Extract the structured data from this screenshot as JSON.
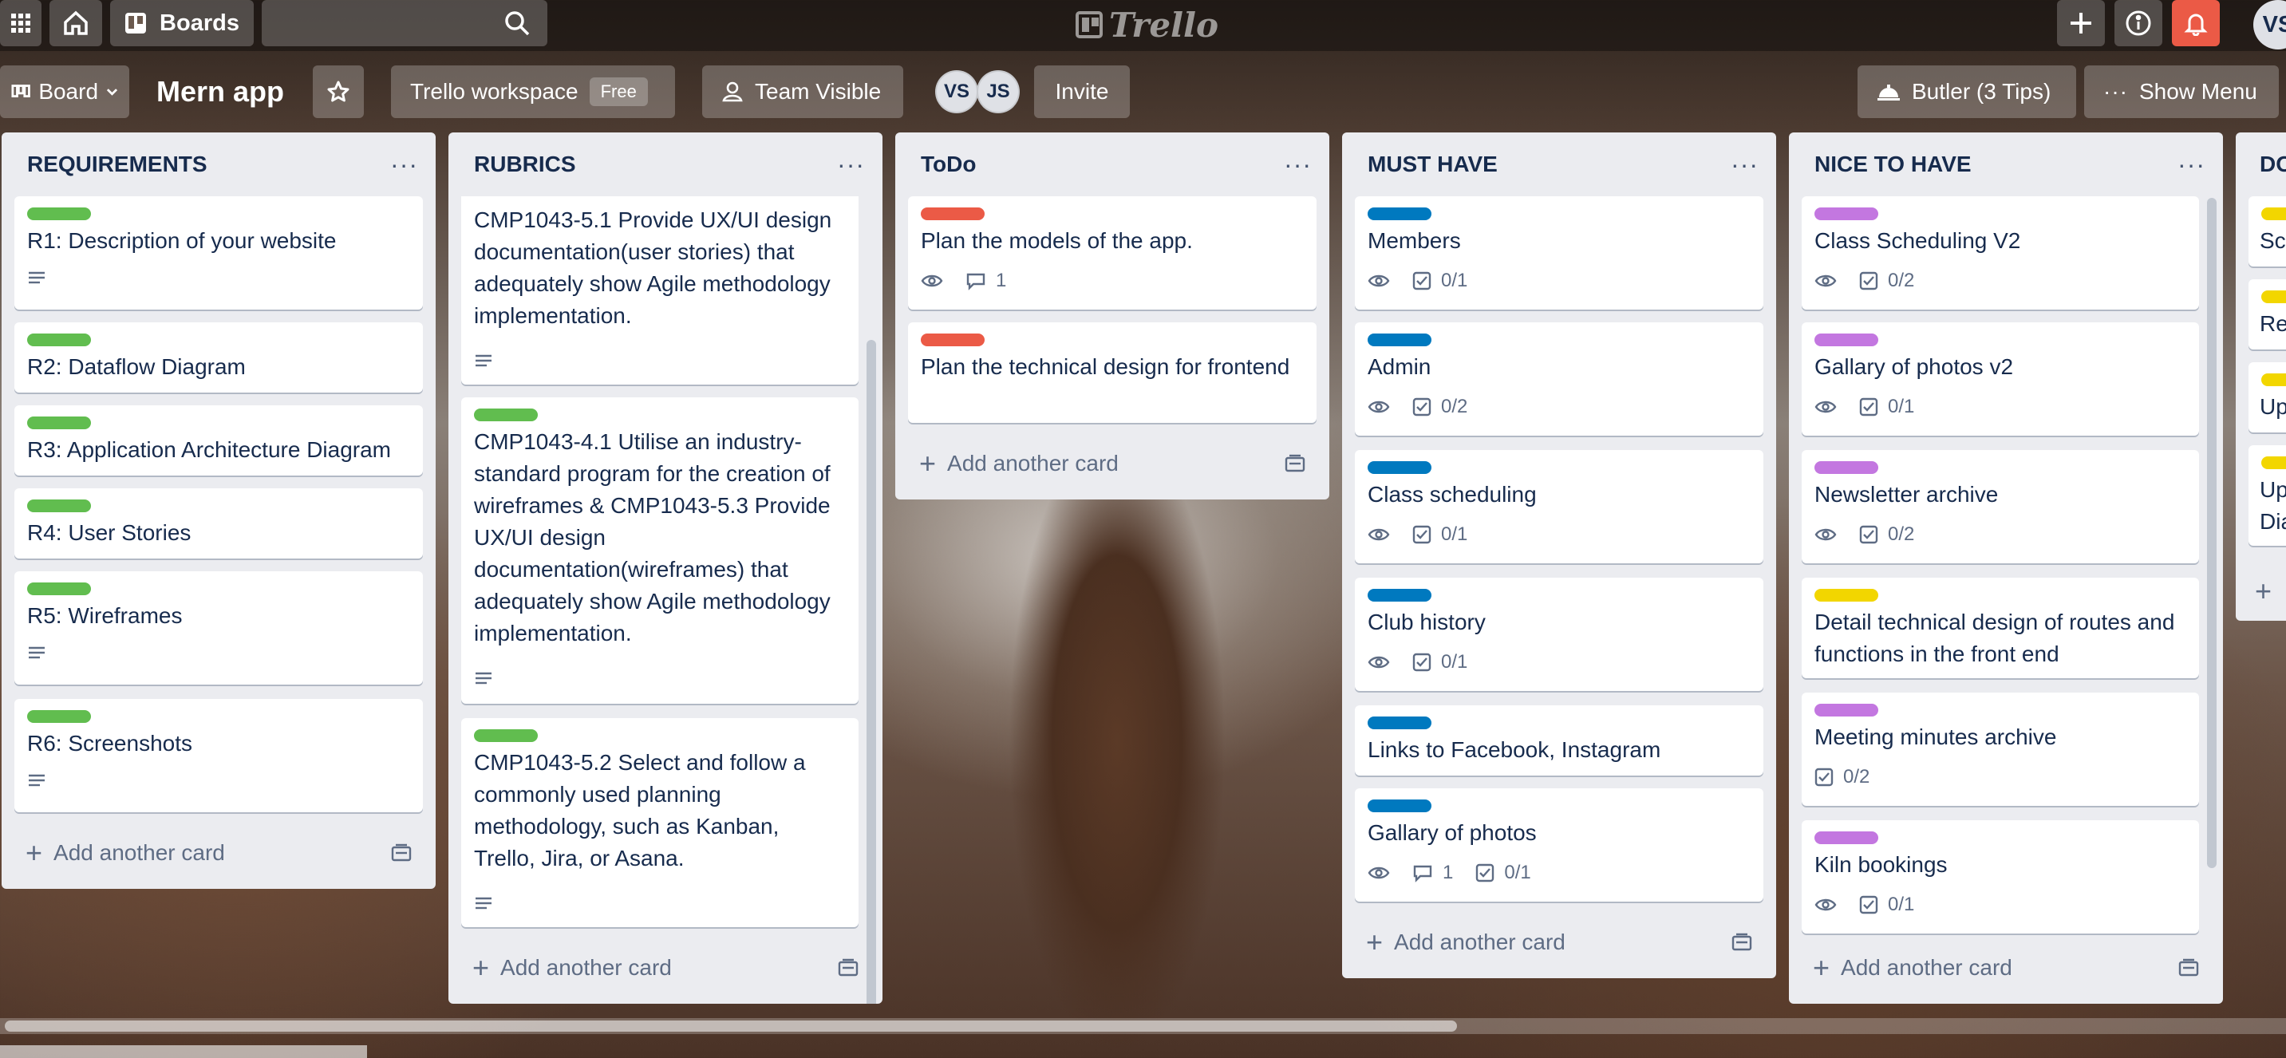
{
  "topbar": {
    "boards_label": "Boards",
    "logo_text": "Trello",
    "user_initials": "VS",
    "notification_color": "#eb5a46"
  },
  "boardbar": {
    "view_label": "Board",
    "board_title": "Mern app",
    "workspace_label": "Trello workspace",
    "workspace_plan": "Free",
    "visibility_label": "Team Visible",
    "members": [
      "VS",
      "JS"
    ],
    "invite_label": "Invite",
    "butler_label": "Butler (3 Tips)",
    "show_menu_label": "Show Menu"
  },
  "colors": {
    "green": "#61bd4f",
    "red": "#eb5a46",
    "blue": "#0079bf",
    "purple": "#c377e0",
    "yellow": "#f2d600"
  },
  "lists": [
    {
      "title": "REQUIREMENTS",
      "add_card_label": "Add another card",
      "cards": [
        {
          "label_color": "green",
          "text": "R1: Description of your website",
          "description": true
        },
        {
          "label_color": "green",
          "text": "R2: Dataflow Diagram"
        },
        {
          "label_color": "green",
          "text": "R3: Application Architecture Diagram"
        },
        {
          "label_color": "green",
          "text": "R4: User Stories"
        },
        {
          "label_color": "green",
          "text": "R5: Wireframes",
          "description": true
        },
        {
          "label_color": "green",
          "text": "R6: Screenshots",
          "description": true
        }
      ]
    },
    {
      "title": "RUBRICS",
      "add_card_label": "Add another card",
      "cards": [
        {
          "label_color": "green",
          "text": "CMP1043-5.1 Provide UX/UI design documentation(user stories) that adequately show Agile methodology implementation.",
          "description": true
        },
        {
          "label_color": "green",
          "text": "CMP1043-4.1 Utilise an industry-standard program for the creation of wireframes & CMP1043-5.3 Provide UX/UI design documentation(wireframes) that adequately show Agile methodology implementation.",
          "description": true
        },
        {
          "label_color": "green",
          "text": "CMP1043-5.2 Select and follow a commonly used planning methodology, such as Kanban, Trello, Jira, or Asana.",
          "description": true
        }
      ]
    },
    {
      "title": "ToDo",
      "add_card_label": "Add another card",
      "cards": [
        {
          "label_color": "red",
          "text": "Plan the models of the app.",
          "watch": true,
          "comments": "1"
        },
        {
          "label_color": "red",
          "text": "Plan the technical design for frontend"
        }
      ]
    },
    {
      "title": "MUST HAVE",
      "add_card_label": "Add another card",
      "cards": [
        {
          "label_color": "blue",
          "text": "Members",
          "watch": true,
          "checklist": "0/1"
        },
        {
          "label_color": "blue",
          "text": "Admin",
          "watch": true,
          "checklist": "0/2"
        },
        {
          "label_color": "blue",
          "text": "Class scheduling",
          "watch": true,
          "checklist": "0/1"
        },
        {
          "label_color": "blue",
          "text": "Club history",
          "watch": true,
          "checklist": "0/1"
        },
        {
          "label_color": "blue",
          "text": "Links to Facebook, Instagram"
        },
        {
          "label_color": "blue",
          "text": "Gallary of photos",
          "watch": true,
          "comments": "1",
          "checklist": "0/1"
        }
      ]
    },
    {
      "title": "NICE TO HAVE",
      "add_card_label": "Add another card",
      "cards": [
        {
          "label_color": "purple",
          "text": "Class Scheduling V2",
          "watch": true,
          "checklist": "0/2"
        },
        {
          "label_color": "purple",
          "text": "Gallary of photos v2",
          "watch": true,
          "checklist": "0/1"
        },
        {
          "label_color": "purple",
          "text": "Newsletter archive",
          "watch": true,
          "checklist": "0/2"
        },
        {
          "label_color": "yellow",
          "text": "Detail technical design of routes and functions in the front end"
        },
        {
          "label_color": "purple",
          "text": "Meeting minutes archive",
          "checklist": "0/2"
        },
        {
          "label_color": "purple",
          "text": "Kiln bookings",
          "watch": true,
          "checklist": "0/1"
        }
      ]
    },
    {
      "title": "DO",
      "cards": [
        {
          "label_color": "yellow",
          "text": "Sc"
        },
        {
          "label_color": "yellow",
          "text": "Re"
        },
        {
          "label_color": "yellow",
          "text": "Up"
        },
        {
          "label_color": "yellow",
          "text": "Up Dia"
        }
      ]
    }
  ]
}
